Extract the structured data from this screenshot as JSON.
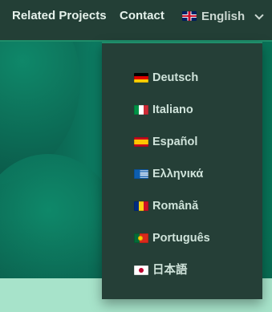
{
  "nav": {
    "links": [
      "Related Projects",
      "Contact"
    ],
    "language": {
      "label": "English",
      "icon": "uk-flag-icon",
      "chevron": "chevron-down-icon"
    }
  },
  "dropdown": {
    "items": [
      {
        "label": "Deutsch",
        "icon": "de-flag-icon"
      },
      {
        "label": "Italiano",
        "icon": "it-flag-icon"
      },
      {
        "label": "Español",
        "icon": "es-flag-icon"
      },
      {
        "label": "Ελληνικά",
        "icon": "gr-flag-icon"
      },
      {
        "label": "Română",
        "icon": "ro-flag-icon"
      },
      {
        "label": "Português",
        "icon": "pt-flag-icon"
      },
      {
        "label": "日本語",
        "icon": "jp-flag-icon"
      }
    ]
  },
  "colors": {
    "navbar_bg": "#233f36",
    "accent": "#1f8d6a",
    "dropdown_bg": "#253f37",
    "page_bottom": "#a7e3ca"
  }
}
